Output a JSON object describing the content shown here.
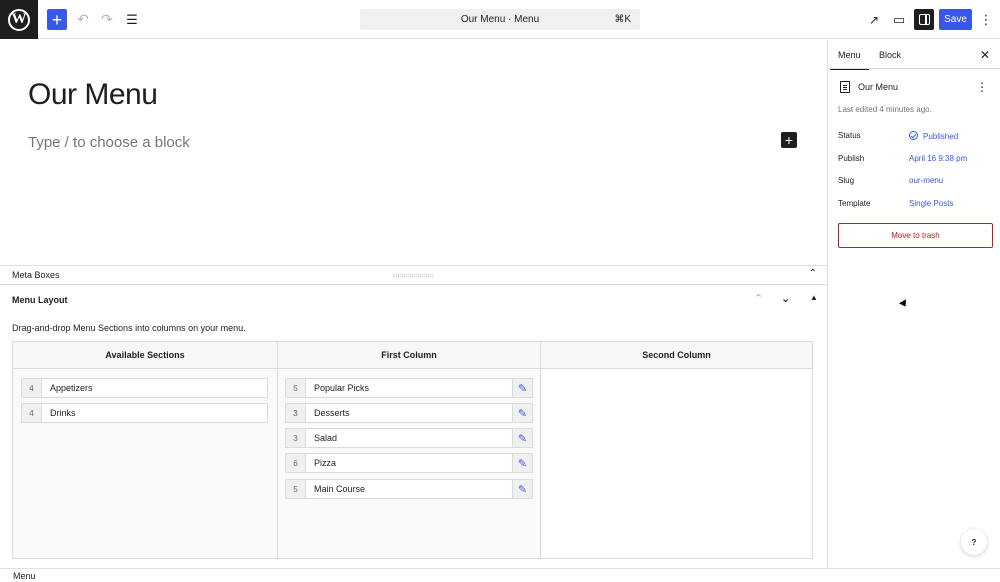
{
  "topbar": {
    "logo_letter": "W",
    "add_icon": "+",
    "undo_icon": "↶",
    "redo_icon": "↷",
    "list_view_icon": "☰",
    "command_title": "Our Menu · Menu",
    "command_shortcut": "⌘K",
    "view_icon": "↗",
    "preview_icon": "▭",
    "save_label": "Save",
    "options_icon": "⋮"
  },
  "editor": {
    "post_title": "Our Menu",
    "block_placeholder": "Type / to choose a block",
    "inline_add_icon": "+"
  },
  "meta_boxes": {
    "title": "Meta Boxes",
    "collapse_icon": "⌃"
  },
  "menu_layout": {
    "title": "Menu Layout",
    "up_icon": "⌃",
    "down_icon": "⌄",
    "toggle_icon": "▲",
    "description": "Drag-and-drop Menu Sections into columns on your menu.",
    "columns": [
      {
        "header": "Available Sections",
        "items": [
          {
            "count": "4",
            "name": "Appetizers"
          },
          {
            "count": "4",
            "name": "Drinks"
          }
        ]
      },
      {
        "header": "First Column",
        "items": [
          {
            "count": "5",
            "name": "Popular Picks"
          },
          {
            "count": "3",
            "name": "Desserts"
          },
          {
            "count": "3",
            "name": "Salad"
          },
          {
            "count": "6",
            "name": "Pizza"
          },
          {
            "count": "5",
            "name": "Main Course"
          }
        ]
      },
      {
        "header": "Second Column",
        "items": []
      }
    ],
    "edit_icon": "✎"
  },
  "footer": {
    "breadcrumb": "Menu"
  },
  "sidebar": {
    "tabs": [
      "Menu",
      "Block"
    ],
    "active_tab": "Menu",
    "close_icon": "✕",
    "post_title": "Our Menu",
    "kebab_icon": "⋮",
    "last_edited": "Last edited 4 minutes ago.",
    "rows": [
      {
        "label": "Status",
        "value": "Published"
      },
      {
        "label": "Publish",
        "value": "April 16 9:38 pm"
      },
      {
        "label": "Slug",
        "value": "our-menu"
      },
      {
        "label": "Template",
        "value": "Single Posts"
      }
    ],
    "trash_label": "Move to trash",
    "help_label": "?"
  },
  "colors": {
    "accent": "#3858e9",
    "dark": "#1e1e1e",
    "danger": "#cc1818"
  }
}
